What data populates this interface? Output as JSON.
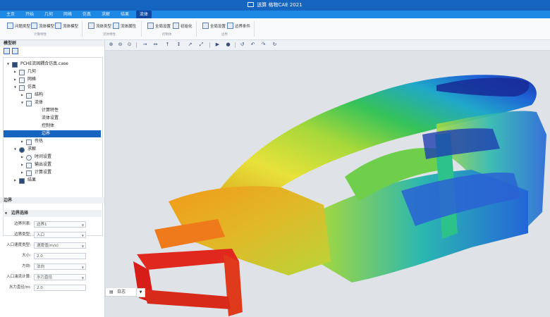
{
  "titlebar": {
    "title": "送算 格物CAE 2021",
    "icon": "window-icon"
  },
  "menu": {
    "tabs": [
      "主页",
      "开始",
      "几何",
      "网格",
      "仿真",
      "求解",
      "结果",
      "流体"
    ],
    "active_index": 7
  },
  "ribbon": {
    "buttons": [
      "问题类型",
      "流体模型",
      "流体模型",
      "流体类型",
      "流体属性",
      "全局设置",
      "初始化",
      "全局设置",
      "边界条件"
    ],
    "groups": [
      "计算特性",
      "流体特性",
      "控制体",
      "边界"
    ]
  },
  "left_panel": {
    "model_tree_title": "模型树",
    "tree": [
      {
        "label": "PCHE流固耦合仿真.case",
        "level": 0,
        "expanded": true,
        "icon": "case-icon"
      },
      {
        "label": "几何",
        "level": 1,
        "expanded": false,
        "icon": "geometry-icon"
      },
      {
        "label": "网格",
        "level": 1,
        "expanded": false,
        "icon": "mesh-icon"
      },
      {
        "label": "仿真",
        "level": 1,
        "expanded": true,
        "icon": "simulation-icon"
      },
      {
        "label": "结构",
        "level": 2,
        "expanded": false,
        "icon": "structure-icon"
      },
      {
        "label": "流体",
        "level": 2,
        "expanded": true,
        "icon": "fluid-icon"
      },
      {
        "label": "计算特性",
        "level": 3,
        "icon": ""
      },
      {
        "label": "流体设置",
        "level": 3,
        "icon": ""
      },
      {
        "label": "控制体",
        "level": 3,
        "icon": ""
      },
      {
        "label": "边界",
        "level": 3,
        "icon": "",
        "selected": true
      },
      {
        "label": "传热",
        "level": 2,
        "expanded": false,
        "icon": "heat-icon"
      },
      {
        "label": "求解",
        "level": 1,
        "expanded": true,
        "icon": "solve-icon"
      },
      {
        "label": "时间设置",
        "level": 2,
        "expanded": false,
        "icon": "clock-icon"
      },
      {
        "label": "输出设置",
        "level": 2,
        "expanded": false,
        "icon": "output-icon"
      },
      {
        "label": "计算设置",
        "level": 2,
        "expanded": false,
        "icon": "compute-icon"
      },
      {
        "label": "结果",
        "level": 1,
        "expanded": false,
        "icon": "result-icon"
      }
    ],
    "props_title": "边界",
    "section_title": "边界选择",
    "fields": [
      {
        "label": "边界列表:",
        "value": "边界1",
        "dropdown": true
      },
      {
        "label": "边界类型:",
        "value": "入口",
        "dropdown": true
      },
      {
        "label": "入口速度类型:",
        "value": "速度值(m/s)",
        "dropdown": true
      },
      {
        "label": "大小:",
        "value": "2.0",
        "dropdown": false
      },
      {
        "label": "方向:",
        "value": "法向",
        "dropdown": true
      },
      {
        "label": "入口湍流计算:",
        "value": "水力直径",
        "dropdown": true
      },
      {
        "label": "水力直径/m:",
        "value": "2.0",
        "dropdown": false
      }
    ]
  },
  "viewport": {
    "bottom_tab": "日志",
    "background": "#dfe2e6"
  },
  "colors": {
    "brand": "#1565c0",
    "menubar": "#1e88e5",
    "selection": "#1565c0"
  }
}
